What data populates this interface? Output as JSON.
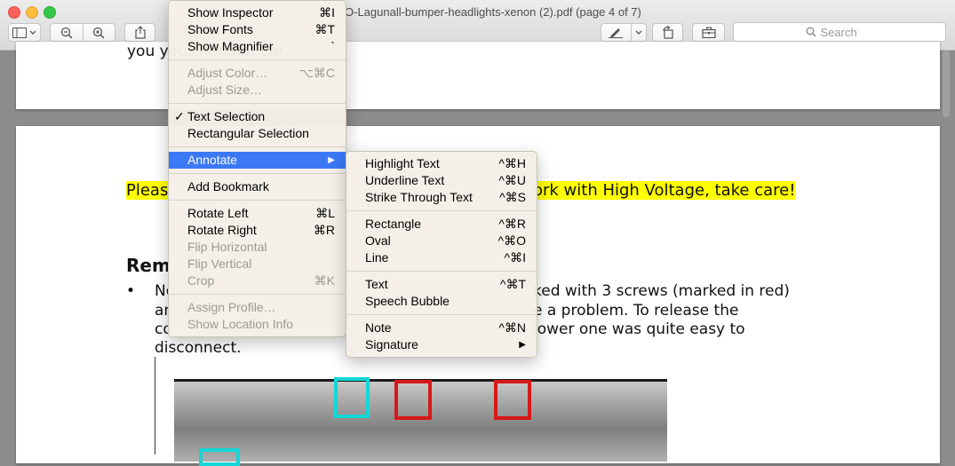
{
  "window": {
    "title": "O-Lagunall-bumper-headlights-xenon (2).pdf (page 4 of 7)"
  },
  "toolbar": {
    "search_placeholder": "Search"
  },
  "document": {
    "top_fragment": "you                        your Renault car.",
    "highlight_left": "Pleas",
    "highlight_right": "ork with High Voltage, take care!",
    "heading": "Rem",
    "bullet": "•",
    "line1_left": "No",
    "line1_right": "ked with 3 screws (marked in red)",
    "line2_left": "ar",
    "line2_right": "e a problem. To release the",
    "line3_left": "co",
    "line3_right": "lower one was quite easy to",
    "line4": "disconnect.",
    "mark_colors": {
      "cyan": "#14d6d6",
      "red": "#d81818"
    }
  },
  "main_menu": {
    "groups": [
      [
        {
          "label": "Show Inspector",
          "shortcut": "⌘I",
          "disabled": false
        },
        {
          "label": "Show Fonts",
          "shortcut": "⌘T",
          "disabled": false
        },
        {
          "label": "Show Magnifier",
          "shortcut": "`",
          "disabled": false
        }
      ],
      [
        {
          "label": "Adjust Color…",
          "shortcut": "⌥⌘C",
          "disabled": true
        },
        {
          "label": "Adjust Size…",
          "shortcut": "",
          "disabled": true
        }
      ],
      [
        {
          "label": "Text Selection",
          "shortcut": "",
          "disabled": false,
          "checked": true
        },
        {
          "label": "Rectangular Selection",
          "shortcut": "",
          "disabled": false
        }
      ],
      [
        {
          "label": "Annotate",
          "shortcut": "",
          "disabled": false,
          "active": true,
          "submenu": true
        }
      ],
      [
        {
          "label": "Add Bookmark",
          "shortcut": "",
          "disabled": false
        }
      ],
      [
        {
          "label": "Rotate Left",
          "shortcut": "⌘L",
          "disabled": false
        },
        {
          "label": "Rotate Right",
          "shortcut": "⌘R",
          "disabled": false
        },
        {
          "label": "Flip Horizontal",
          "shortcut": "",
          "disabled": true
        },
        {
          "label": "Flip Vertical",
          "shortcut": "",
          "disabled": true
        },
        {
          "label": "Crop",
          "shortcut": "⌘K",
          "disabled": true
        }
      ],
      [
        {
          "label": "Assign Profile…",
          "shortcut": "",
          "disabled": true
        },
        {
          "label": "Show Location Info",
          "shortcut": "",
          "disabled": true
        }
      ]
    ]
  },
  "annotate_menu": {
    "groups": [
      [
        {
          "label": "Highlight Text",
          "shortcut": "^⌘H"
        },
        {
          "label": "Underline Text",
          "shortcut": "^⌘U"
        },
        {
          "label": "Strike Through Text",
          "shortcut": "^⌘S"
        }
      ],
      [
        {
          "label": "Rectangle",
          "shortcut": "^⌘R"
        },
        {
          "label": "Oval",
          "shortcut": "^⌘O"
        },
        {
          "label": "Line",
          "shortcut": "^⌘I"
        }
      ],
      [
        {
          "label": "Text",
          "shortcut": "^⌘T"
        },
        {
          "label": "Speech Bubble",
          "shortcut": ""
        }
      ],
      [
        {
          "label": "Note",
          "shortcut": "^⌘N"
        },
        {
          "label": "Signature",
          "shortcut": "",
          "submenu": true
        }
      ]
    ]
  }
}
